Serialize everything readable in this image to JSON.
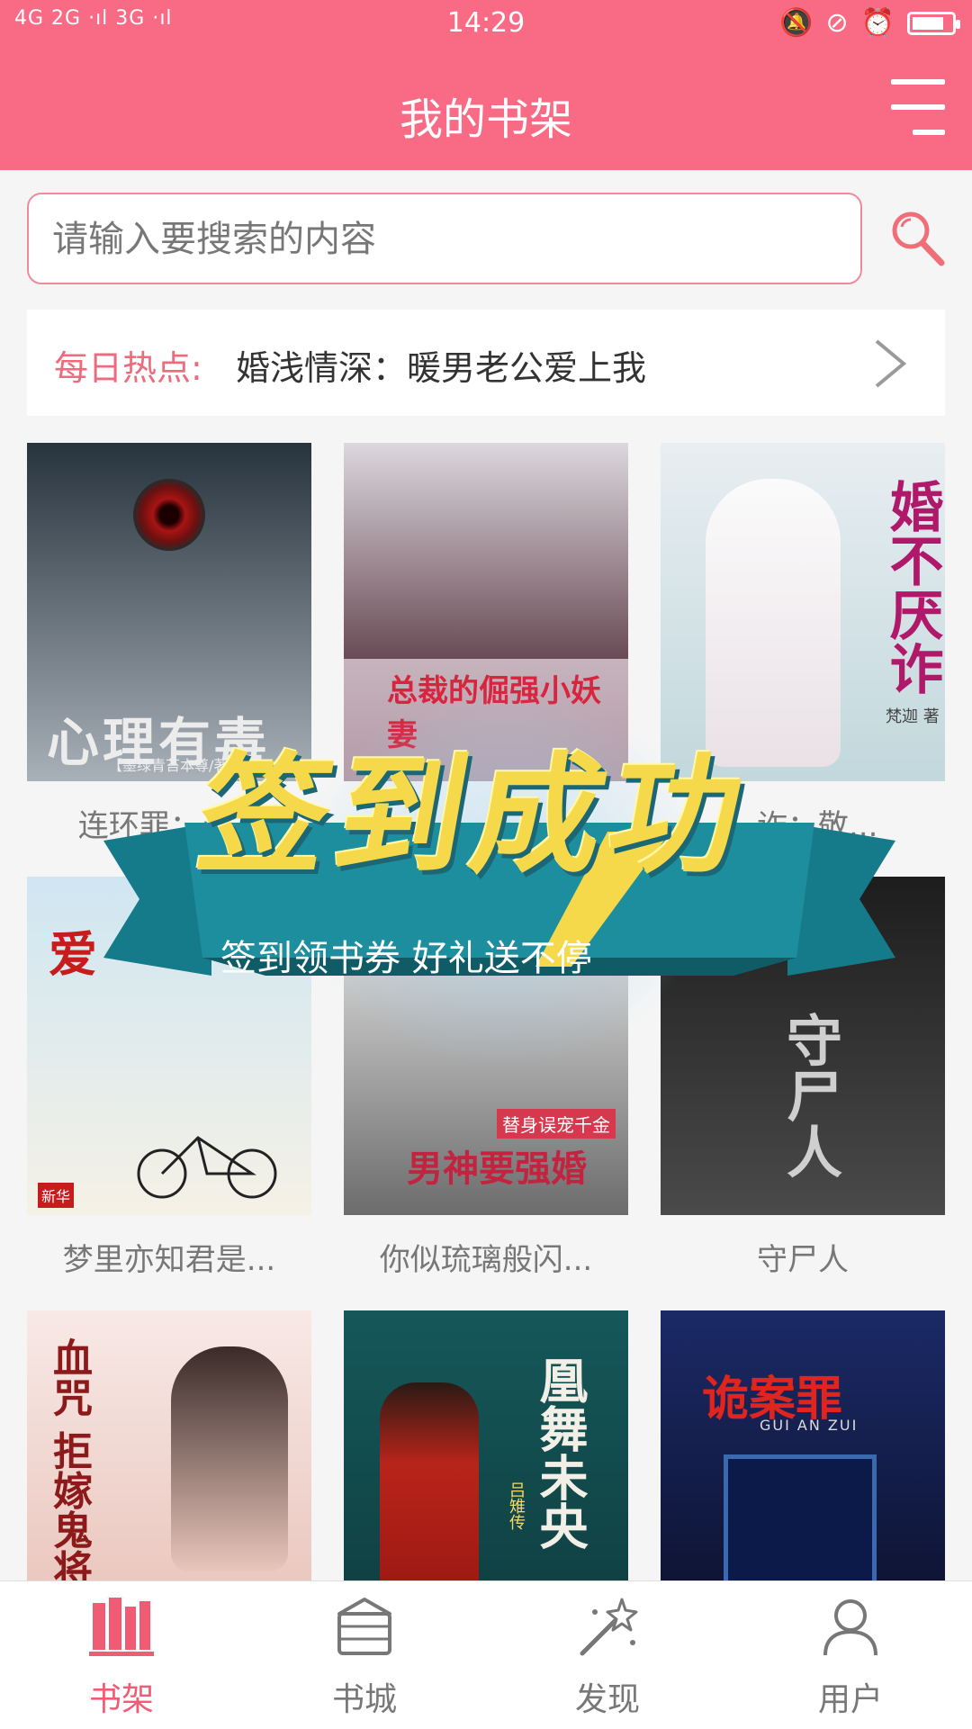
{
  "status_bar": {
    "network": "4G 2G ·ıl 3G ·ıl",
    "time": "14:29"
  },
  "header": {
    "title": "我的书架"
  },
  "search": {
    "placeholder": "请输入要搜索的内容"
  },
  "daily_hot": {
    "label": "每日热点:",
    "text": "婚浅情深：暖男老公爱上我"
  },
  "books": [
    {
      "name": "连环罪：心...",
      "cover_text": "心理有毒",
      "cover_sub": "【墨绿青苔本尊/著】",
      "colors": [
        "#27333d",
        "#a8b0b8"
      ]
    },
    {
      "name": "",
      "cover_text": "总裁的倔强小妖妻",
      "cover_sub": "",
      "colors": [
        "#e6e2e6",
        "#b49aa6"
      ]
    },
    {
      "name": "...诈：敬...",
      "cover_text": "婚不厌诈",
      "cover_sub": "梵迦 著",
      "colors": [
        "#e8eef2",
        "#c2d8dc"
      ]
    },
    {
      "name": "梦里亦知君是...",
      "cover_text": "爱",
      "cover_sub": "新华",
      "colors": [
        "#cfe6f2",
        "#f5f1e6"
      ]
    },
    {
      "name": "你似琉璃般闪...",
      "cover_text": "男神要强婚",
      "cover_sub": "替身误宠千金",
      "colors": [
        "#f1f1f1",
        "#6c6c6c"
      ]
    },
    {
      "name": "守尸人",
      "cover_text": "守尸人",
      "cover_sub": "",
      "colors": [
        "#1d1d1d",
        "#4a4a4a"
      ]
    },
    {
      "name": "",
      "cover_text": "血咒 拒嫁鬼将军",
      "cover_sub": "",
      "colors": [
        "#f8e9e6",
        "#e7c0b6"
      ]
    },
    {
      "name": "",
      "cover_text": "凰舞未央",
      "cover_sub": "吕雉传",
      "colors": [
        "#15585a",
        "#0f3c3e"
      ]
    },
    {
      "name": "",
      "cover_text": "诡案罪",
      "cover_sub": "GUI AN ZUI",
      "colors": [
        "#1b2a66",
        "#0b0f2a"
      ]
    }
  ],
  "popup": {
    "title": "签到成功",
    "subtitle": "签到领书券 好礼送不停"
  },
  "bottom_nav": [
    {
      "label": "书架",
      "active": true,
      "icon": "bookshelf-icon"
    },
    {
      "label": "书城",
      "active": false,
      "icon": "bookstore-icon"
    },
    {
      "label": "发现",
      "active": false,
      "icon": "magic-wand-icon"
    },
    {
      "label": "用户",
      "active": false,
      "icon": "user-icon"
    }
  ],
  "colors": {
    "accent": "#f96b85",
    "nav_active": "#f05c74",
    "nav_inactive": "#777777"
  }
}
